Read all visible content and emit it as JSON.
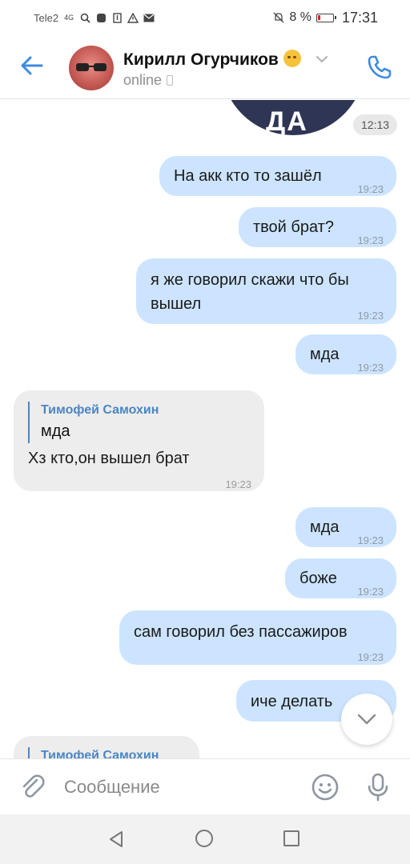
{
  "status_bar": {
    "carrier": "Tele2",
    "network": "4G",
    "battery_percent": "8 %",
    "time": "17:31"
  },
  "header": {
    "contact_name": "Кирилл Огурчиков",
    "status": "online",
    "icons": [
      "back-arrow-icon",
      "chevron-down-icon",
      "phone-call-icon"
    ]
  },
  "sticker": {
    "text": "ДА",
    "time": "12:13"
  },
  "messages": [
    {
      "side": "out",
      "text": "На акк кто то зашёл",
      "time": "19:23"
    },
    {
      "side": "out",
      "text": "твой брат?",
      "time": "19:23"
    },
    {
      "side": "out",
      "text": "я же говорил скажи что бы вышел",
      "time": "19:23"
    },
    {
      "side": "out",
      "text": "мда",
      "time": "19:23"
    },
    {
      "side": "in",
      "quote_author": "Тимофей Самохин",
      "quote_text": "мда",
      "text": "Хз кто,он вышел брат",
      "time": "19:23"
    },
    {
      "side": "out",
      "text": "мда",
      "time": "19:23"
    },
    {
      "side": "out",
      "text": "боже",
      "time": "19:23"
    },
    {
      "side": "out",
      "text": "сам говорил без пассажиров",
      "time": "19:23"
    },
    {
      "side": "out",
      "text": "иче делать"
    },
    {
      "side": "in",
      "quote_author": "Тимофей Самохин"
    }
  ],
  "composer": {
    "placeholder": "Сообщение"
  },
  "colors": {
    "accent": "#4a86c5",
    "outgoing_bubble": "#cce4ff",
    "incoming_bubble": "#ededed"
  }
}
